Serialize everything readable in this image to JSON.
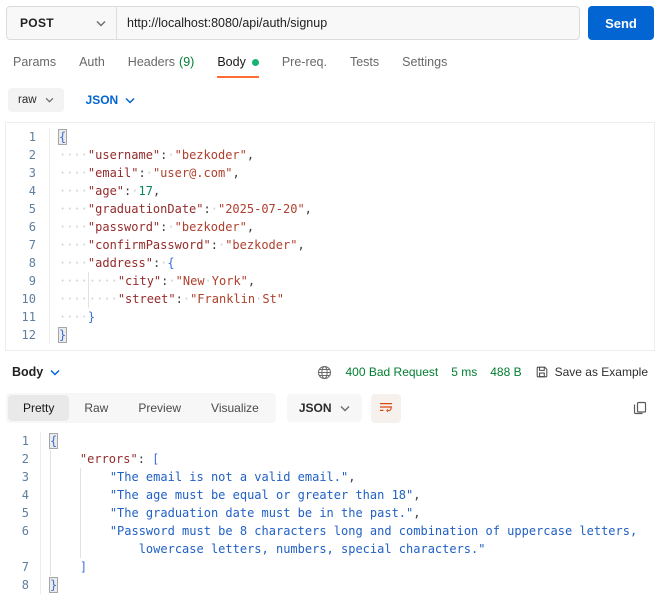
{
  "colors": {
    "accent_orange": "#ff6c37",
    "send_blue": "#0265d2",
    "status_green": "#007f31"
  },
  "request_bar": {
    "method": "POST",
    "url": "http://localhost:8080/api/auth/signup",
    "send_label": "Send"
  },
  "request_tabs": {
    "items": [
      {
        "label": "Params"
      },
      {
        "label": "Auth"
      },
      {
        "label": "Headers",
        "count": "(9)"
      },
      {
        "label": "Body",
        "active": true,
        "dot": true
      },
      {
        "label": "Pre-req."
      },
      {
        "label": "Tests"
      },
      {
        "label": "Settings"
      }
    ]
  },
  "body_toolbar": {
    "type": "raw",
    "format": "JSON"
  },
  "request_editor": {
    "lines": [
      {
        "n": "1",
        "tokens": [
          {
            "t": "{",
            "c": "b hl"
          }
        ]
      },
      {
        "n": "2",
        "tokens": [
          {
            "t": "····",
            "c": "ws"
          },
          {
            "t": "\"username\"",
            "c": "k"
          },
          {
            "t": ":",
            "c": "p"
          },
          {
            "t": "·",
            "c": "ws"
          },
          {
            "t": "\"bezkoder\"",
            "c": "s"
          },
          {
            "t": ",",
            "c": "p"
          }
        ]
      },
      {
        "n": "3",
        "tokens": [
          {
            "t": "····",
            "c": "ws"
          },
          {
            "t": "\"email\"",
            "c": "k"
          },
          {
            "t": ":",
            "c": "p"
          },
          {
            "t": "·",
            "c": "ws"
          },
          {
            "t": "\"user@.com\"",
            "c": "s"
          },
          {
            "t": ",",
            "c": "p"
          }
        ]
      },
      {
        "n": "4",
        "tokens": [
          {
            "t": "····",
            "c": "ws"
          },
          {
            "t": "\"age\"",
            "c": "k"
          },
          {
            "t": ":",
            "c": "p"
          },
          {
            "t": "·",
            "c": "ws"
          },
          {
            "t": "17",
            "c": "n"
          },
          {
            "t": ",",
            "c": "p"
          }
        ]
      },
      {
        "n": "5",
        "tokens": [
          {
            "t": "····",
            "c": "ws"
          },
          {
            "t": "\"graduationDate\"",
            "c": "k"
          },
          {
            "t": ":",
            "c": "p"
          },
          {
            "t": "·",
            "c": "ws"
          },
          {
            "t": "\"2025-07-20\"",
            "c": "s"
          },
          {
            "t": ",",
            "c": "p"
          }
        ]
      },
      {
        "n": "6",
        "tokens": [
          {
            "t": "····",
            "c": "ws"
          },
          {
            "t": "\"password\"",
            "c": "k"
          },
          {
            "t": ":",
            "c": "p"
          },
          {
            "t": "·",
            "c": "ws"
          },
          {
            "t": "\"bezkoder\"",
            "c": "s"
          },
          {
            "t": ",",
            "c": "p"
          }
        ]
      },
      {
        "n": "7",
        "tokens": [
          {
            "t": "····",
            "c": "ws"
          },
          {
            "t": "\"confirmPassword\"",
            "c": "k"
          },
          {
            "t": ":",
            "c": "p"
          },
          {
            "t": "·",
            "c": "ws"
          },
          {
            "t": "\"bezkoder\"",
            "c": "s"
          },
          {
            "t": ",",
            "c": "p"
          }
        ]
      },
      {
        "n": "8",
        "tokens": [
          {
            "t": "····",
            "c": "ws"
          },
          {
            "t": "\"address\"",
            "c": "k"
          },
          {
            "t": ":",
            "c": "p"
          },
          {
            "t": "·",
            "c": "ws"
          },
          {
            "t": "{",
            "c": "b"
          }
        ]
      },
      {
        "n": "9",
        "tokens": [
          {
            "t": "····",
            "c": "ws"
          },
          {
            "t": "",
            "c": "gd"
          },
          {
            "t": "····",
            "c": "ws"
          },
          {
            "t": "\"city\"",
            "c": "k"
          },
          {
            "t": ":",
            "c": "p"
          },
          {
            "t": "·",
            "c": "ws"
          },
          {
            "t": "\"New",
            "c": "s"
          },
          {
            "t": "·",
            "c": "ws"
          },
          {
            "t": "York\"",
            "c": "s"
          },
          {
            "t": ",",
            "c": "p"
          }
        ]
      },
      {
        "n": "10",
        "tokens": [
          {
            "t": "····",
            "c": "ws"
          },
          {
            "t": "",
            "c": "gd"
          },
          {
            "t": "····",
            "c": "ws"
          },
          {
            "t": "\"street\"",
            "c": "k"
          },
          {
            "t": ":",
            "c": "p"
          },
          {
            "t": "·",
            "c": "ws"
          },
          {
            "t": "\"Franklin",
            "c": "s"
          },
          {
            "t": "·",
            "c": "ws"
          },
          {
            "t": "St\"",
            "c": "s"
          }
        ]
      },
      {
        "n": "11",
        "tokens": [
          {
            "t": "····",
            "c": "ws"
          },
          {
            "t": "}",
            "c": "b"
          }
        ]
      },
      {
        "n": "12",
        "tokens": [
          {
            "t": "}",
            "c": "b hl"
          }
        ]
      }
    ]
  },
  "response_meta": {
    "label": "Body",
    "status": "400 Bad Request",
    "time": "5 ms",
    "size": "488 B",
    "save_label": "Save as Example"
  },
  "response_toolbar": {
    "tabs": [
      {
        "label": "Pretty",
        "active": true
      },
      {
        "label": "Raw"
      },
      {
        "label": "Preview"
      },
      {
        "label": "Visualize"
      }
    ],
    "format": "JSON"
  },
  "response_editor": {
    "lines": [
      {
        "n": "1",
        "tokens": [
          {
            "t": "{",
            "c": "b hl"
          }
        ]
      },
      {
        "n": "2",
        "tokens": [
          {
            "t": "",
            "c": "gd"
          },
          {
            "t": "    ",
            "c": "p"
          },
          {
            "t": "\"errors\"",
            "c": "k"
          },
          {
            "t": ":",
            "c": "p"
          },
          {
            "t": " ",
            "c": "p"
          },
          {
            "t": "[",
            "c": "b"
          }
        ]
      },
      {
        "n": "3",
        "tokens": [
          {
            "t": "",
            "c": "gd"
          },
          {
            "t": "    ",
            "c": "p"
          },
          {
            "t": "",
            "c": "gd"
          },
          {
            "t": "    ",
            "c": "p"
          },
          {
            "t": "\"The email is not a valid email.\"",
            "c": "rs"
          },
          {
            "t": ",",
            "c": "p"
          }
        ]
      },
      {
        "n": "4",
        "tokens": [
          {
            "t": "",
            "c": "gd"
          },
          {
            "t": "    ",
            "c": "p"
          },
          {
            "t": "",
            "c": "gd"
          },
          {
            "t": "    ",
            "c": "p"
          },
          {
            "t": "\"The age must be equal or greater than 18\"",
            "c": "rs"
          },
          {
            "t": ",",
            "c": "p"
          }
        ]
      },
      {
        "n": "5",
        "tokens": [
          {
            "t": "",
            "c": "gd"
          },
          {
            "t": "    ",
            "c": "p"
          },
          {
            "t": "",
            "c": "gd"
          },
          {
            "t": "    ",
            "c": "p"
          },
          {
            "t": "\"The graduation date must be in the past.\"",
            "c": "rs"
          },
          {
            "t": ",",
            "c": "p"
          }
        ]
      },
      {
        "n": "6",
        "tokens": [
          {
            "t": "",
            "c": "gd"
          },
          {
            "t": "    ",
            "c": "p"
          },
          {
            "t": "",
            "c": "gd"
          },
          {
            "t": "    ",
            "c": "p"
          },
          {
            "t": "\"Password must be 8 characters long and combination of uppercase letters,",
            "c": "rs"
          }
        ]
      },
      {
        "n": "",
        "tokens": [
          {
            "t": "",
            "c": "gd"
          },
          {
            "t": "    ",
            "c": "p"
          },
          {
            "t": "",
            "c": "gd"
          },
          {
            "t": "        ",
            "c": "p"
          },
          {
            "t": "lowercase letters, numbers, special characters.\"",
            "c": "rs"
          }
        ]
      },
      {
        "n": "7",
        "tokens": [
          {
            "t": "",
            "c": "gd"
          },
          {
            "t": "    ",
            "c": "p"
          },
          {
            "t": "]",
            "c": "b"
          }
        ]
      },
      {
        "n": "8",
        "tokens": [
          {
            "t": "}",
            "c": "b hl"
          }
        ]
      }
    ]
  }
}
